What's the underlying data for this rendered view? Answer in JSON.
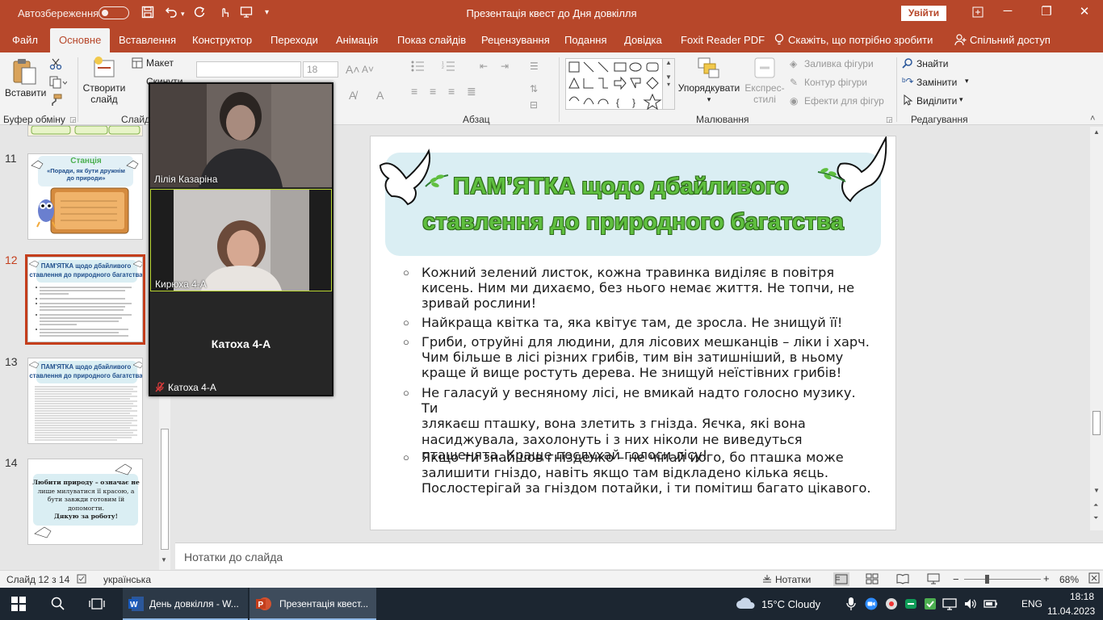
{
  "titlebar": {
    "autosave_label": "Автозбереження",
    "doc_title": "Презентація квест до Дня довкілля",
    "signin_label": "Увійти",
    "minimize": "─",
    "restore": "❐",
    "close": "✕"
  },
  "tabs": [
    {
      "label": "Файл"
    },
    {
      "label": "Основне"
    },
    {
      "label": "Вставлення"
    },
    {
      "label": "Конструктор"
    },
    {
      "label": "Переходи"
    },
    {
      "label": "Анімація"
    },
    {
      "label": "Показ слайдів"
    },
    {
      "label": "Рецензування"
    },
    {
      "label": "Подання"
    },
    {
      "label": "Довідка"
    },
    {
      "label": "Foxit Reader PDF"
    }
  ],
  "tell_me": "Скажіть, що потрібно зробити",
  "share": "Спільний доступ",
  "ribbon": {
    "clipboard": {
      "paste": "Вставити",
      "group": "Буфер обміну"
    },
    "slides": {
      "new_slide_1": "Створити",
      "new_slide_2": "слайд",
      "layout": "Макет",
      "reset": "Скинути",
      "group": "Слайди"
    },
    "font": {
      "size": "18"
    },
    "paragraph": {
      "group": "Абзац"
    },
    "drawing": {
      "arrange": "Упорядкувати",
      "quick_styles_1": "Експрес-",
      "quick_styles_2": "стилі",
      "fill": "Заливка фігури",
      "outline": "Контур фігури",
      "effects": "Ефекти для фігур",
      "group": "Малювання"
    },
    "editing": {
      "find": "Знайти",
      "replace": "Замінити",
      "select": "Виділити",
      "group": "Редагування"
    }
  },
  "slides_panel": {
    "numbers": [
      "11",
      "12",
      "13",
      "14"
    ],
    "thumb11": {
      "title1": "Станція",
      "title2": "«Поради, як бути дружнім",
      "title3": "до природи»"
    },
    "thumb12": {
      "title1": "ПАМ'ЯТКА щодо дбайливого",
      "title2": "ставлення до природного багатства"
    },
    "thumb13": {
      "title1": "ПАМ'ЯТКА щодо дбайливого",
      "title2": "ставлення до природного багатства"
    },
    "thumb14": {
      "line1": "Любити природу – означає не",
      "line2": "лише милуватися її красою, а",
      "line3": "бути завжди готовим їй",
      "line4": "допомогти.",
      "line5": "Дякую за роботу!"
    }
  },
  "video": {
    "participants": [
      {
        "name": "Лілія Казаріна"
      },
      {
        "name": "Кирюха 4-А"
      },
      {
        "name": "Катоха 4-А",
        "center_label": "Катоха 4-А"
      }
    ]
  },
  "slide": {
    "title_line1": "ПАМ’ЯТКА щодо дбайливого",
    "title_line2": "ставлення до природного багатства",
    "bullet_symbol": "○",
    "bullets": [
      {
        "lines": [
          "Кожний зелений листок, кожна травинка виділяє в повітря",
          "кисень. Ним ми дихаємо, без нього немає життя. Не топчи, не",
          "зривай рослини!"
        ]
      },
      {
        "lines": [
          "Найкраща квітка та, яка квітує там, де зросла. Не знищуй її!"
        ]
      },
      {
        "lines": [
          "Гриби, отруйні для людини, для лісових мешканців – ліки і харч.",
          "Чим більше в лісі різних грибів, тим він затишніший, в ньому",
          "краще й вище ростуть дерева. Не знищуй неїстівних грибів!"
        ]
      },
      {
        "lines": [
          "Не галасуй у весняному лісі, не вмикай надто голосно музику. Ти",
          "злякаєш пташку, вона злетить з гнізда. Яєчка, які вона",
          "насиджувала, захолонуть і з них ніколи не виведуться",
          "пташенята. Краще послухай голоси лісу!"
        ]
      },
      {
        "lines": [
          "Якщо ти знайшов гніздечко – не чіпай його, бо пташка може",
          "залишити гніздо, навіть якщо там відкладено кілька яєць.",
          "Послостерігай за гніздом потайки, і ти помітиш багато цікавого."
        ]
      }
    ]
  },
  "notes_placeholder": "Нотатки до слайда",
  "statusbar": {
    "slide_of": "Слайд 12 з 14",
    "language": "українська",
    "notes_btn": "Нотатки",
    "zoom": "68%"
  },
  "taskbar": {
    "word_task": "День довкілля - W...",
    "ppt_task": "Презентація квест...",
    "weather": "15°C  Cloudy",
    "lang": "ENG",
    "time": "18:18",
    "date": "11.04.2023"
  },
  "colors": {
    "accent": "#b7472a",
    "title_green": "#5fbf3f",
    "selection": "#c43e1c"
  }
}
